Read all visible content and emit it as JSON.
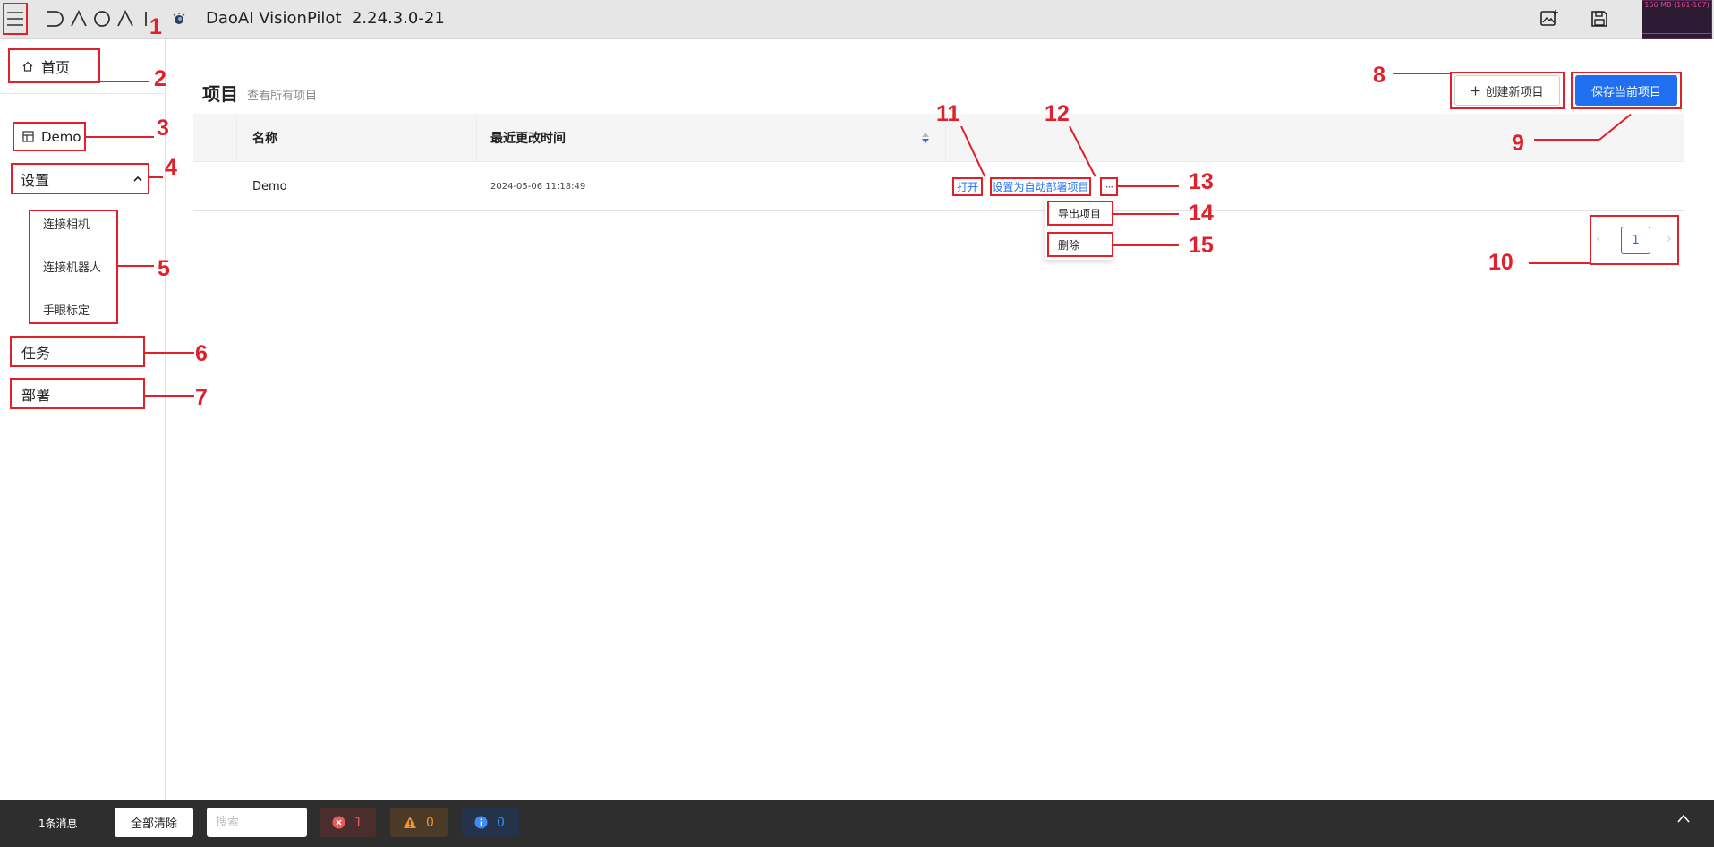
{
  "topbar": {
    "logo_text": "DAOAI",
    "app_title": "DaoAI VisionPilot",
    "version": "2.24.3.0-21",
    "memory_text": "166 MB (161-167)"
  },
  "sidebar": {
    "home_label": "首页",
    "project_label": "Demo",
    "settings_label": "设置",
    "settings_items": [
      "连接相机",
      "连接机器人",
      "手眼标定"
    ],
    "task_label": "任务",
    "deploy_label": "部署"
  },
  "main": {
    "title": "项目",
    "subtitle": "查看所有项目",
    "create_label": "创建新项目",
    "save_label": "保存当前项目",
    "columns": [
      "名称",
      "最近更改时间"
    ],
    "rows": [
      {
        "name": "Demo",
        "modified": "2024-05-06 11:18:49"
      }
    ],
    "actions": {
      "open": "打开",
      "set_auto_deploy": "设置为自动部署项目",
      "more": "···"
    },
    "dropdown": [
      "导出项目",
      "删除"
    ],
    "pagination": {
      "current": "1"
    }
  },
  "statusbar": {
    "message_count": "1条消息",
    "clear_label": "全部清除",
    "search_placeholder": "搜索",
    "error_count": "1",
    "warning_count": "0",
    "info_count": "0"
  },
  "annotations": [
    "1",
    "2",
    "3",
    "4",
    "5",
    "6",
    "7",
    "8",
    "9",
    "10",
    "11",
    "12",
    "13",
    "14",
    "15"
  ],
  "colors": {
    "accent": "#1f6ff0",
    "annotation": "#e0202a",
    "statusbar": "#2e2e2e"
  },
  "icons": [
    "menu-icon",
    "home-icon",
    "project-icon",
    "chevron-up-icon",
    "plus-icon",
    "sort-icon",
    "image-add-icon",
    "save-icon",
    "error-icon",
    "warning-icon",
    "info-icon",
    "eye-icon"
  ]
}
